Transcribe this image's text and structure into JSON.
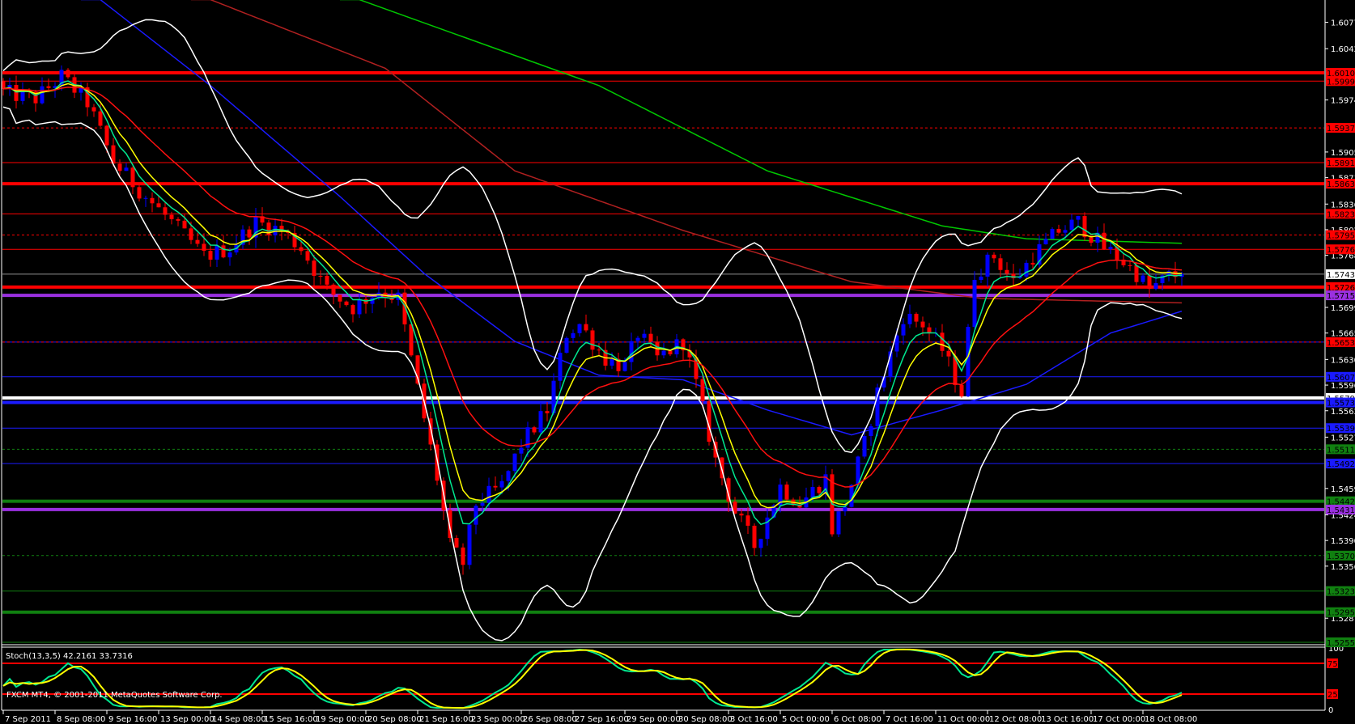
{
  "chart_data": {
    "type": "candlestick",
    "symbol_info": "FXCM MT4, © 2001-2011 MetaQuotes Software Corp.",
    "current_price": "1.57431",
    "price_ticks": [
      "1.60770",
      "1.60420",
      "1.59740",
      "1.59050",
      "1.58710",
      "1.58360",
      "1.58020",
      "1.57680",
      "1.56990",
      "1.56650",
      "1.56300",
      "1.55960",
      "1.55620",
      "1.55270",
      "1.54590",
      "1.54240",
      "1.53900",
      "1.53560",
      "1.52870"
    ],
    "time_labels": [
      "7 Sep 2011",
      "8 Sep 08:00",
      "9 Sep 16:00",
      "13 Sep 00:00",
      "14 Sep 08:00",
      "15 Sep 16:00",
      "19 Sep 00:00",
      "20 Sep 08:00",
      "21 Sep 16:00",
      "23 Sep 00:00",
      "26 Sep 08:00",
      "27 Sep 16:00",
      "29 Sep 00:00",
      "30 Sep 08:00",
      "3 Oct 16:00",
      "5 Oct 00:00",
      "6 Oct 08:00",
      "7 Oct 16:00",
      "11 Oct 00:00",
      "12 Oct 08:00",
      "13 Oct 16:00",
      "17 Oct 00:00",
      "18 Oct 08:00"
    ],
    "bars_per_label": 8,
    "bar_count": 183,
    "close_path": [
      [
        0,
        1.5985
      ],
      [
        1,
        1.5982
      ],
      [
        5,
        1.5976
      ],
      [
        9,
        1.6005
      ],
      [
        13,
        1.5971
      ],
      [
        17,
        1.5892
      ],
      [
        22,
        1.5846
      ],
      [
        26,
        1.5812
      ],
      [
        31,
        1.5767
      ],
      [
        35,
        1.5778
      ],
      [
        39,
        1.5812
      ],
      [
        43,
        1.5801
      ],
      [
        46,
        1.5778
      ],
      [
        50,
        1.5722
      ],
      [
        54,
        1.5699
      ],
      [
        58,
        1.5722
      ],
      [
        61,
        1.5711
      ],
      [
        63,
        1.5631
      ],
      [
        65,
        1.5552
      ],
      [
        67,
        1.5473
      ],
      [
        69,
        1.5383
      ],
      [
        71,
        1.536
      ],
      [
        73,
        1.5439
      ],
      [
        77,
        1.5462
      ],
      [
        80,
        1.5518
      ],
      [
        84,
        1.5563
      ],
      [
        87,
        1.5665
      ],
      [
        89,
        1.5677
      ],
      [
        93,
        1.5631
      ],
      [
        96,
        1.562
      ],
      [
        98,
        1.5665
      ],
      [
        101,
        1.5631
      ],
      [
        105,
        1.5654
      ],
      [
        107,
        1.5597
      ],
      [
        110,
        1.5496
      ],
      [
        113,
        1.5428
      ],
      [
        116,
        1.5383
      ],
      [
        120,
        1.5462
      ],
      [
        123,
        1.5439
      ],
      [
        127,
        1.5473
      ],
      [
        128,
        1.5405
      ],
      [
        130,
        1.5439
      ],
      [
        133,
        1.5518
      ],
      [
        135,
        1.5586
      ],
      [
        139,
        1.5688
      ],
      [
        142,
        1.5677
      ],
      [
        145,
        1.5643
      ],
      [
        148,
        1.5586
      ],
      [
        150,
        1.5744
      ],
      [
        153,
        1.5767
      ],
      [
        156,
        1.5733
      ],
      [
        159,
        1.5767
      ],
      [
        163,
        1.5801
      ],
      [
        166,
        1.5812
      ],
      [
        170,
        1.5778
      ],
      [
        172,
        1.5767
      ],
      [
        175,
        1.5744
      ],
      [
        177,
        1.5722
      ],
      [
        180,
        1.574
      ],
      [
        182,
        1.57431
      ]
    ],
    "moving_averages": [
      {
        "name": "MA slow green",
        "color": "#00c800",
        "path": [
          [
            55,
            1.6107
          ],
          [
            92,
            1.5993
          ],
          [
            118,
            1.588
          ],
          [
            145,
            1.5807
          ],
          [
            158,
            1.579
          ],
          [
            182,
            1.5784
          ]
        ]
      },
      {
        "name": "MA dark red",
        "color": "#b02020",
        "path": [
          [
            32,
            1.6107
          ],
          [
            59,
            1.6016
          ],
          [
            79,
            1.588
          ],
          [
            105,
            1.5801
          ],
          [
            131,
            1.5733
          ],
          [
            151,
            1.5711
          ],
          [
            182,
            1.5705
          ]
        ]
      },
      {
        "name": "MA blue",
        "color": "#1a1aff",
        "path": [
          [
            15,
            1.6107
          ],
          [
            32,
            1.5993
          ],
          [
            52,
            1.5846
          ],
          [
            65,
            1.5744
          ],
          [
            79,
            1.5654
          ],
          [
            92,
            1.5609
          ],
          [
            105,
            1.5603
          ],
          [
            118,
            1.5563
          ],
          [
            131,
            1.553
          ],
          [
            145,
            1.5563
          ],
          [
            158,
            1.5597
          ],
          [
            171,
            1.5665
          ],
          [
            182,
            1.5694
          ]
        ]
      }
    ],
    "ema_lines": [
      {
        "period": 5,
        "color": "#00e890"
      },
      {
        "period": 8,
        "color": "#ffff00"
      },
      {
        "period": 21,
        "color": "#ff1010"
      }
    ],
    "bollinger": {
      "period": 20,
      "deviation": 2,
      "color": "#ffffff"
    },
    "levels": [
      {
        "price": "1.60100",
        "color": "#ff0000",
        "style": "thick"
      },
      {
        "price": "1.59990",
        "color": "#ff0000",
        "style": "solid"
      },
      {
        "price": "1.59370",
        "color": "#ff0000",
        "style": "dashed"
      },
      {
        "price": "1.58910",
        "color": "#ff0000",
        "style": "solid"
      },
      {
        "price": "1.58630",
        "color": "#ff0000",
        "style": "thick"
      },
      {
        "price": "1.58230",
        "color": "#ff0000",
        "style": "solid"
      },
      {
        "price": "1.57950",
        "color": "#ff0000",
        "style": "dashed"
      },
      {
        "price": "1.57760",
        "color": "#ff0000",
        "style": "solid"
      },
      {
        "price": "1.57431",
        "color": "#909090",
        "style": "solid",
        "label_bg": "#ffffff"
      },
      {
        "price": "1.57260",
        "color": "#ff0000",
        "style": "thick"
      },
      {
        "price": "1.57150",
        "color": "#9a30e0",
        "style": "thick"
      },
      {
        "price": "1.56530",
        "color": "#ff0000",
        "style": "dashed",
        "under": "#1a1aff"
      },
      {
        "price": "1.56070",
        "color": "#1a1aff",
        "style": "solid"
      },
      {
        "price": "1.55790",
        "color": "#ffffff",
        "style": "thick"
      },
      {
        "price": "1.55730",
        "color": "#1a1aff",
        "style": "thick"
      },
      {
        "price": "1.55390",
        "color": "#1a1aff",
        "style": "solid"
      },
      {
        "price": "1.55110",
        "color": "#108010",
        "style": "dashed"
      },
      {
        "price": "1.54920",
        "color": "#1a1aff",
        "style": "solid"
      },
      {
        "price": "1.54420",
        "color": "#108010",
        "style": "thick"
      },
      {
        "price": "1.54310",
        "color": "#9a30e0",
        "style": "thick"
      },
      {
        "price": "1.53700",
        "color": "#108010",
        "style": "dashed"
      },
      {
        "price": "1.53230",
        "color": "#108010",
        "style": "solid"
      },
      {
        "price": "1.52950",
        "color": "#108010",
        "style": "thick"
      },
      {
        "price": "1.52550",
        "color": "#108010",
        "style": "solid"
      }
    ],
    "stochastic": {
      "title": "Stoch(13,3,5) 42.2161 33.7316",
      "k": 13,
      "d": 3,
      "slowing": 5,
      "levels": [
        "75",
        "25"
      ],
      "scale_labels": [
        "100",
        "0"
      ],
      "k_color": "#00e890",
      "d_color": "#ffff00"
    },
    "colors": {
      "bull": "#0000ff",
      "bear": "#ff0000",
      "axis": "#ffffff",
      "background": "#000000"
    }
  }
}
